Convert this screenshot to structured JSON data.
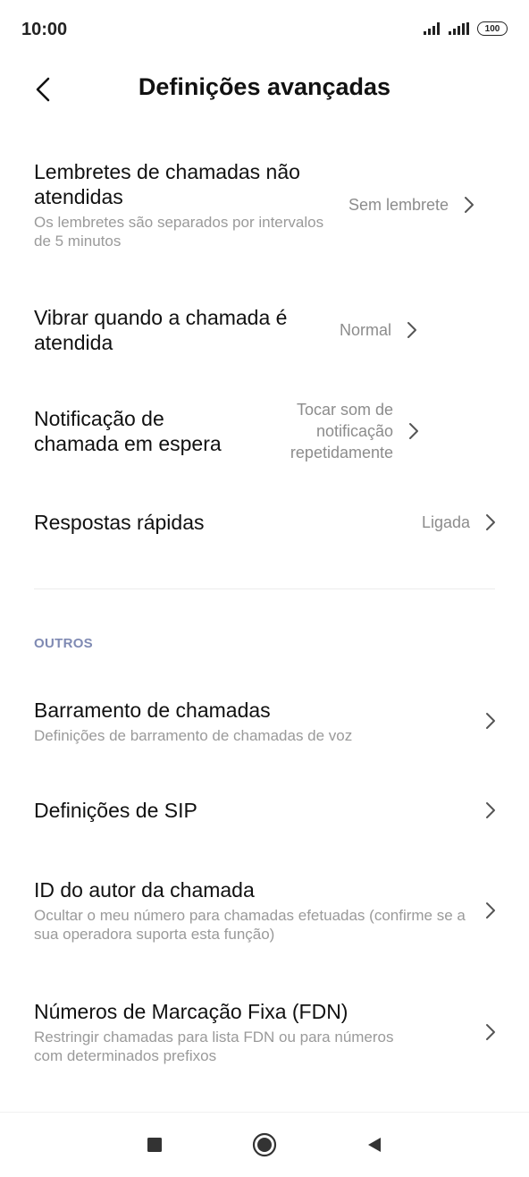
{
  "status_bar": {
    "time": "10:00",
    "battery": "100"
  },
  "header": {
    "title": "Definições avançadas"
  },
  "settings": [
    {
      "title": "Lembretes de chamadas não atendidas",
      "subtitle": "Os lembretes são separados por intervalos de 5 minutos",
      "value": "Sem lembrete"
    },
    {
      "title": "Vibrar quando a chamada é atendida",
      "subtitle": "",
      "value": "Normal"
    },
    {
      "title": "Notificação de chamada em espera",
      "subtitle": "",
      "value": "Tocar som de notificação repetidamente"
    },
    {
      "title": "Respostas rápidas",
      "subtitle": "",
      "value": "Ligada"
    }
  ],
  "others_section": {
    "header": "OUTROS",
    "items": [
      {
        "title": "Barramento de chamadas",
        "subtitle": "Definições de barramento de chamadas de voz"
      },
      {
        "title": "Definições de SIP",
        "subtitle": ""
      },
      {
        "title": "ID do autor da chamada",
        "subtitle": "Ocultar o meu número para chamadas efetuadas (confirme se a sua operadora suporta esta função)"
      },
      {
        "title": "Números de Marcação Fixa (FDN)",
        "subtitle": "Restringir chamadas para lista FDN ou para números com determinados prefixos"
      }
    ]
  },
  "icons": {
    "back": "chevron-left-icon",
    "row_arrow": "chevron-right-icon",
    "nav_recents": "square-icon",
    "nav_home": "circle-icon",
    "nav_back": "triangle-left-icon"
  },
  "colors": {
    "section_header": "#7f8ab3",
    "secondary_text": "#9a9a9a"
  }
}
